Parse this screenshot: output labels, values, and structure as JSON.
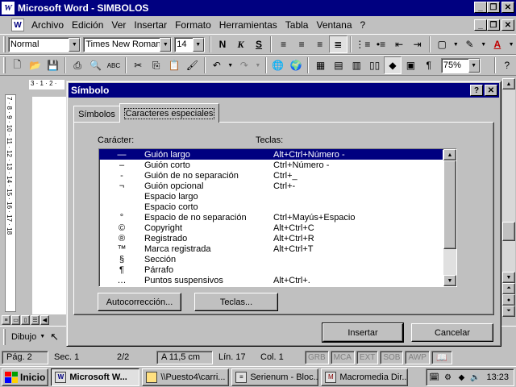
{
  "window": {
    "title": "Microsoft Word - SIMBOLOS"
  },
  "menu": [
    "Archivo",
    "Edición",
    "Ver",
    "Insertar",
    "Formato",
    "Herramientas",
    "Tabla",
    "Ventana",
    "?"
  ],
  "formatting": {
    "style": "Normal",
    "font": "Times New Roman",
    "size": "14",
    "bold": "N",
    "italic": "K",
    "underline": "S"
  },
  "standard": {
    "zoom": "75%"
  },
  "ruler_text": "3 · 1 · 2 ·",
  "vertical_ruler": "7 · 8 · 9 · 10 · 11 · 12 · 13 · 14 · 15 · 16 · 17 · 18",
  "dialog": {
    "title": "Símbolo",
    "tabs": {
      "simbolos": "Símbolos",
      "caracteres": "Caracteres especiales"
    },
    "col_char": "Carácter:",
    "col_keys": "Teclas:",
    "rows": [
      {
        "char": "—",
        "name": "Guión largo",
        "keys": "Alt+Ctrl+Número -",
        "selected": true
      },
      {
        "char": "–",
        "name": "Guión corto",
        "keys": "Ctrl+Número -"
      },
      {
        "char": "-",
        "name": "Guión de no separación",
        "keys": "Ctrl+_"
      },
      {
        "char": "¬",
        "name": "Guión opcional",
        "keys": "Ctrl+-"
      },
      {
        "char": "",
        "name": "Espacio largo",
        "keys": ""
      },
      {
        "char": "",
        "name": "Espacio corto",
        "keys": ""
      },
      {
        "char": "°",
        "name": "Espacio de no separación",
        "keys": "Ctrl+Mayús+Espacio"
      },
      {
        "char": "©",
        "name": "Copyright",
        "keys": "Alt+Ctrl+C"
      },
      {
        "char": "®",
        "name": "Registrado",
        "keys": "Alt+Ctrl+R"
      },
      {
        "char": "™",
        "name": "Marca registrada",
        "keys": "Alt+Ctrl+T"
      },
      {
        "char": "§",
        "name": "Sección",
        "keys": ""
      },
      {
        "char": "¶",
        "name": "Párrafo",
        "keys": ""
      },
      {
        "char": "…",
        "name": "Puntos suspensivos",
        "keys": "Alt+Ctrl+."
      }
    ],
    "buttons": {
      "autocorreccion": "Autocorrección...",
      "teclas": "Teclas...",
      "insertar": "Insertar",
      "cancelar": "Cancelar"
    }
  },
  "drawing": {
    "label": "Dibujo"
  },
  "status": {
    "page": "Pág. 2",
    "section": "Sec. 1",
    "pages": "2/2",
    "at": "A 11,5 cm",
    "line": "Lín. 17",
    "col": "Col. 1",
    "modes": [
      "GRB",
      "MCA",
      "EXT",
      "SOB",
      "AWP"
    ]
  },
  "taskbar": {
    "start": "Inicio",
    "tasks": [
      "Microsoft W...",
      "\\\\Puesto4\\carri...",
      "Serienum - Bloc...",
      "Macromedia Dir..."
    ],
    "clock": "13:23"
  }
}
